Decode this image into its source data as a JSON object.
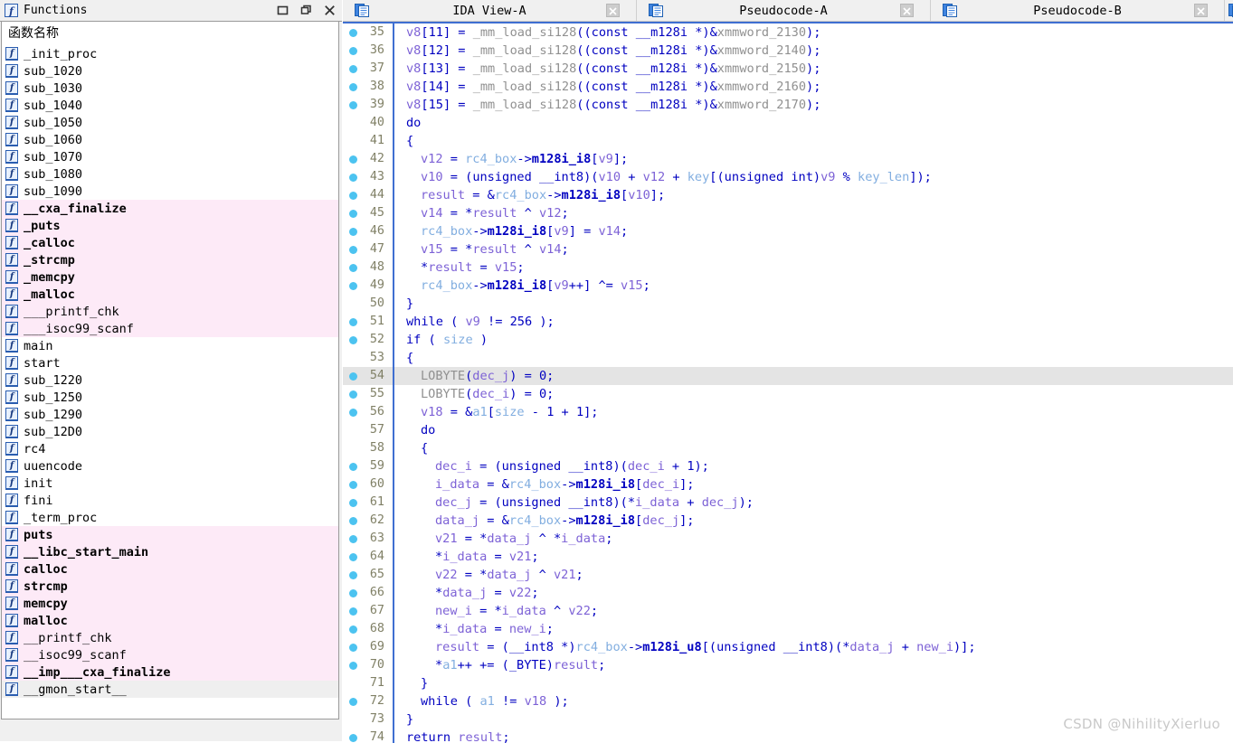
{
  "functions_window": {
    "title": "Functions",
    "title_icon": "function-icon",
    "window_buttons": [
      {
        "name": "maximize-button",
        "glyph": "maximize-icon"
      },
      {
        "name": "restore-button",
        "glyph": "restore-icon"
      },
      {
        "name": "close-button",
        "glyph": "close-icon"
      }
    ],
    "column_header": "函数名称",
    "row_icon": "f",
    "rows": [
      {
        "name": "_init_proc",
        "style": "plain"
      },
      {
        "name": "sub_1020",
        "style": "plain"
      },
      {
        "name": "sub_1030",
        "style": "plain"
      },
      {
        "name": "sub_1040",
        "style": "plain"
      },
      {
        "name": "sub_1050",
        "style": "plain"
      },
      {
        "name": "sub_1060",
        "style": "plain"
      },
      {
        "name": "sub_1070",
        "style": "plain"
      },
      {
        "name": "sub_1080",
        "style": "plain"
      },
      {
        "name": "sub_1090",
        "style": "plain"
      },
      {
        "name": "__cxa_finalize",
        "style": "pink-bold"
      },
      {
        "name": "_puts",
        "style": "pink-bold"
      },
      {
        "name": "_calloc",
        "style": "pink-bold"
      },
      {
        "name": "_strcmp",
        "style": "pink-bold"
      },
      {
        "name": "_memcpy",
        "style": "pink-bold"
      },
      {
        "name": "_malloc",
        "style": "pink-bold"
      },
      {
        "name": "___printf_chk",
        "style": "pink"
      },
      {
        "name": "___isoc99_scanf",
        "style": "pink"
      },
      {
        "name": "main",
        "style": "plain"
      },
      {
        "name": "start",
        "style": "plain"
      },
      {
        "name": "sub_1220",
        "style": "plain"
      },
      {
        "name": "sub_1250",
        "style": "plain"
      },
      {
        "name": "sub_1290",
        "style": "plain"
      },
      {
        "name": "sub_12D0",
        "style": "plain"
      },
      {
        "name": "rc4",
        "style": "plain"
      },
      {
        "name": "uuencode",
        "style": "plain"
      },
      {
        "name": "init",
        "style": "plain"
      },
      {
        "name": "fini",
        "style": "plain"
      },
      {
        "name": "_term_proc",
        "style": "plain"
      },
      {
        "name": "puts",
        "style": "pink-bold"
      },
      {
        "name": "__libc_start_main",
        "style": "pink-bold"
      },
      {
        "name": "calloc",
        "style": "pink-bold"
      },
      {
        "name": "strcmp",
        "style": "pink-bold"
      },
      {
        "name": "memcpy",
        "style": "pink-bold"
      },
      {
        "name": "malloc",
        "style": "pink-bold"
      },
      {
        "name": "__printf_chk",
        "style": "pink"
      },
      {
        "name": "__isoc99_scanf",
        "style": "pink"
      },
      {
        "name": "__imp___cxa_finalize",
        "style": "pink-bold"
      },
      {
        "name": "__gmon_start__",
        "style": "gray"
      }
    ]
  },
  "tabs": [
    {
      "label": "IDA View-A",
      "icon": "document-icon",
      "close": "close-icon",
      "active": false
    },
    {
      "label": "Pseudocode-A",
      "icon": "document-icon",
      "close": "close-icon",
      "active": false
    },
    {
      "label": "Pseudocode-B",
      "icon": "document-icon",
      "close": "close-icon",
      "active": true
    },
    {
      "label": "",
      "icon": "document-icon",
      "close": "",
      "active": false
    }
  ],
  "code": {
    "first_line": 35,
    "highlighted_line": 54,
    "caret_line": 54,
    "lines": [
      {
        "n": 35,
        "bp": true,
        "indent": 0,
        "text": "v8[11] = _mm_load_si128((const __m128i *)&xmmword_2130);"
      },
      {
        "n": 36,
        "bp": true,
        "indent": 0,
        "text": "v8[12] = _mm_load_si128((const __m128i *)&xmmword_2140);"
      },
      {
        "n": 37,
        "bp": true,
        "indent": 0,
        "text": "v8[13] = _mm_load_si128((const __m128i *)&xmmword_2150);"
      },
      {
        "n": 38,
        "bp": true,
        "indent": 0,
        "text": "v8[14] = _mm_load_si128((const __m128i *)&xmmword_2160);"
      },
      {
        "n": 39,
        "bp": true,
        "indent": 0,
        "text": "v8[15] = _mm_load_si128((const __m128i *)&xmmword_2170);"
      },
      {
        "n": 40,
        "bp": false,
        "indent": 0,
        "text": "do"
      },
      {
        "n": 41,
        "bp": false,
        "indent": 0,
        "text": "{"
      },
      {
        "n": 42,
        "bp": true,
        "indent": 1,
        "text": "v12 = rc4_box->m128i_i8[v9];"
      },
      {
        "n": 43,
        "bp": true,
        "indent": 1,
        "text": "v10 = (unsigned __int8)(v10 + v12 + key[(unsigned int)v9 % key_len]);"
      },
      {
        "n": 44,
        "bp": true,
        "indent": 1,
        "text": "result = &rc4_box->m128i_i8[v10];"
      },
      {
        "n": 45,
        "bp": true,
        "indent": 1,
        "text": "v14 = *result ^ v12;"
      },
      {
        "n": 46,
        "bp": true,
        "indent": 1,
        "text": "rc4_box->m128i_i8[v9] = v14;"
      },
      {
        "n": 47,
        "bp": true,
        "indent": 1,
        "text": "v15 = *result ^ v14;"
      },
      {
        "n": 48,
        "bp": true,
        "indent": 1,
        "text": "*result = v15;"
      },
      {
        "n": 49,
        "bp": true,
        "indent": 1,
        "text": "rc4_box->m128i_i8[v9++] ^= v15;"
      },
      {
        "n": 50,
        "bp": false,
        "indent": 0,
        "text": "}"
      },
      {
        "n": 51,
        "bp": true,
        "indent": 0,
        "text": "while ( v9 != 256 );"
      },
      {
        "n": 52,
        "bp": true,
        "indent": 0,
        "text": "if ( size )"
      },
      {
        "n": 53,
        "bp": false,
        "indent": 0,
        "text": "{"
      },
      {
        "n": 54,
        "bp": true,
        "indent": 1,
        "text": "LOBYTE(dec_j) = 0;"
      },
      {
        "n": 55,
        "bp": true,
        "indent": 1,
        "text": "LOBYTE(dec_i) = 0;"
      },
      {
        "n": 56,
        "bp": true,
        "indent": 1,
        "text": "v18 = &a1[size - 1 + 1];"
      },
      {
        "n": 57,
        "bp": false,
        "indent": 1,
        "text": "do"
      },
      {
        "n": 58,
        "bp": false,
        "indent": 1,
        "text": "{"
      },
      {
        "n": 59,
        "bp": true,
        "indent": 2,
        "text": "dec_i = (unsigned __int8)(dec_i + 1);"
      },
      {
        "n": 60,
        "bp": true,
        "indent": 2,
        "text": "i_data = &rc4_box->m128i_i8[dec_i];"
      },
      {
        "n": 61,
        "bp": true,
        "indent": 2,
        "text": "dec_j = (unsigned __int8)(*i_data + dec_j);"
      },
      {
        "n": 62,
        "bp": true,
        "indent": 2,
        "text": "data_j = &rc4_box->m128i_i8[dec_j];"
      },
      {
        "n": 63,
        "bp": true,
        "indent": 2,
        "text": "v21 = *data_j ^ *i_data;"
      },
      {
        "n": 64,
        "bp": true,
        "indent": 2,
        "text": "*i_data = v21;"
      },
      {
        "n": 65,
        "bp": true,
        "indent": 2,
        "text": "v22 = *data_j ^ v21;"
      },
      {
        "n": 66,
        "bp": true,
        "indent": 2,
        "text": "*data_j = v22;"
      },
      {
        "n": 67,
        "bp": true,
        "indent": 2,
        "text": "new_i = *i_data ^ v22;"
      },
      {
        "n": 68,
        "bp": true,
        "indent": 2,
        "text": "*i_data = new_i;"
      },
      {
        "n": 69,
        "bp": true,
        "indent": 2,
        "text": "result = (__int8 *)rc4_box->m128i_u8[(unsigned __int8)(*data_j + new_i)];"
      },
      {
        "n": 70,
        "bp": true,
        "indent": 2,
        "text": "*a1++ += (_BYTE)result;"
      },
      {
        "n": 71,
        "bp": false,
        "indent": 1,
        "text": "}"
      },
      {
        "n": 72,
        "bp": true,
        "indent": 1,
        "text": "while ( a1 != v18 );"
      },
      {
        "n": 73,
        "bp": false,
        "indent": 0,
        "text": "}"
      },
      {
        "n": 74,
        "bp": true,
        "indent": 0,
        "text": "return result;"
      }
    ]
  },
  "watermark": "CSDN @NihilityXierluo",
  "colors": {
    "keyword": "#0000c0",
    "local_var": "#7d62d6",
    "argument": "#82aee0",
    "type_gray": "#909090",
    "struct_member": "#0000c0",
    "breakpoint_dot": "#4cc3f0",
    "gutter_bar": "#3f6fd1",
    "line_highlight": "#e4e4e4",
    "pink_row": "#fdeaf7",
    "gray_row": "#efefef",
    "line_number": "#808066"
  }
}
